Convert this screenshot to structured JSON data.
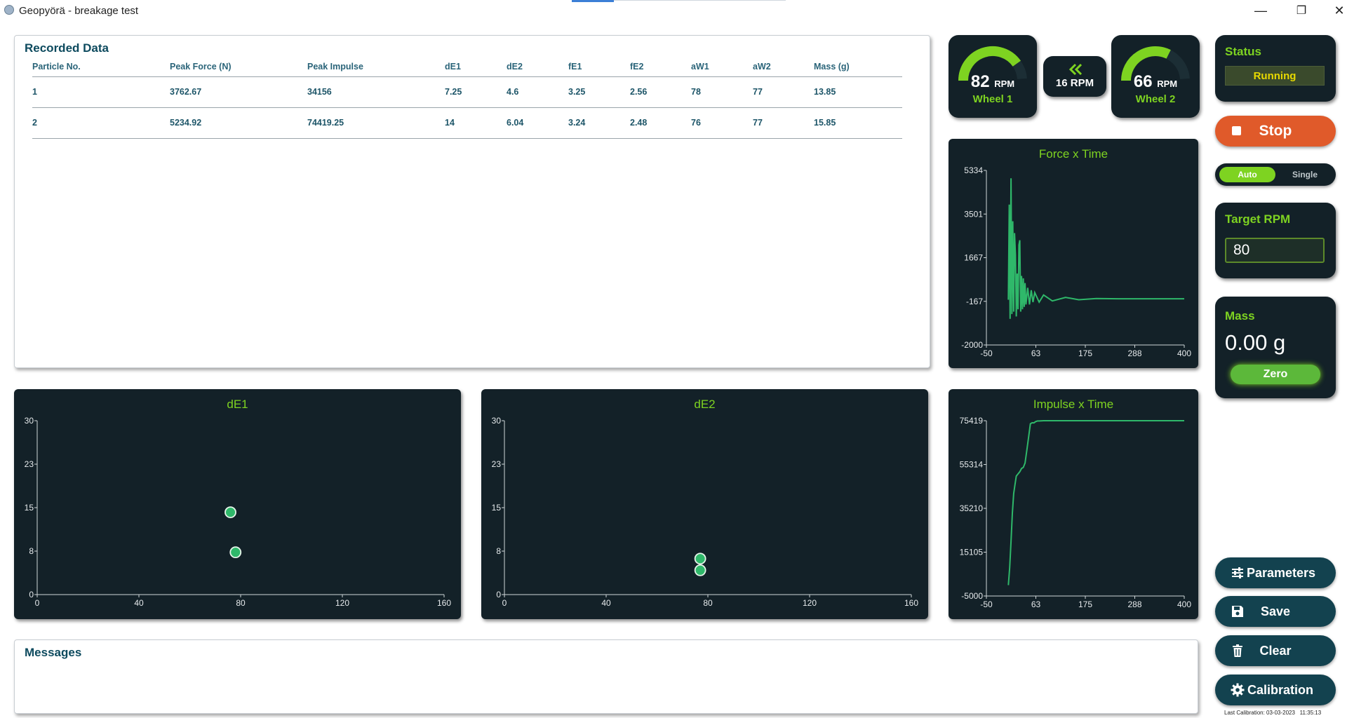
{
  "window": {
    "title": "Geopyörä - breakage test",
    "minimize": "—",
    "restore": "❐",
    "close": "✕"
  },
  "recorded": {
    "title": "Recorded Data",
    "columns": [
      "Particle No.",
      "Peak Force (N)",
      "Peak Impulse",
      "dE1",
      "dE2",
      "fE1",
      "fE2",
      "aW1",
      "aW2",
      "Mass (g)"
    ],
    "rows": [
      [
        "1",
        "3762.67",
        "34156",
        "7.25",
        "4.6",
        "3.25",
        "2.56",
        "78",
        "77",
        "13.85"
      ],
      [
        "2",
        "5234.92",
        "74419.25",
        "14",
        "6.04",
        "3.24",
        "2.48",
        "76",
        "77",
        "15.85"
      ]
    ]
  },
  "gauges": {
    "wheel1": {
      "value": "82",
      "unit": "RPM",
      "label": "Wheel 1",
      "fraction": 0.82
    },
    "diff": {
      "icon": "double-chevron-left-icon",
      "value": "16 RPM"
    },
    "wheel2": {
      "value": "66",
      "unit": "RPM",
      "label": "Wheel 2",
      "fraction": 0.66
    }
  },
  "status": {
    "title": "Status",
    "value": "Running"
  },
  "stop_label": "Stop",
  "mode": {
    "options": [
      "Auto",
      "Single"
    ],
    "selected": "Auto"
  },
  "target_rpm": {
    "title": "Target RPM",
    "value": "80"
  },
  "mass": {
    "title": "Mass",
    "value": "0.00 g",
    "zero_label": "Zero"
  },
  "buttons": {
    "parameters": "Parameters",
    "save": "Save",
    "clear": "Clear",
    "calibration": "Calibration"
  },
  "last_calibration": "Last Calibration: 03-03-2023   11:35:13",
  "messages": {
    "title": "Messages"
  },
  "colors": {
    "accent_green": "#7ed321",
    "line_green": "#2fb86a",
    "panel_dark": "#132128",
    "stop_orange": "#e05a2a",
    "teal_button": "#13424f"
  },
  "chart_data": [
    {
      "type": "scatter",
      "title": "dE1",
      "xlim": [
        0,
        160
      ],
      "ylim": [
        0,
        30
      ],
      "xticks": [
        "0",
        "40",
        "80",
        "120",
        "160"
      ],
      "yticks": [
        "0",
        "8",
        "15",
        "23",
        "30"
      ],
      "points": [
        [
          76,
          14.2
        ],
        [
          78,
          7.3
        ]
      ]
    },
    {
      "type": "scatter",
      "title": "dE2",
      "xlim": [
        0,
        160
      ],
      "ylim": [
        0,
        30
      ],
      "xticks": [
        "0",
        "40",
        "80",
        "120",
        "160"
      ],
      "yticks": [
        "0",
        "8",
        "15",
        "23",
        "30"
      ],
      "points": [
        [
          77,
          6.2
        ],
        [
          77,
          4.2
        ]
      ]
    },
    {
      "type": "line",
      "title": "Force x Time",
      "xlim": [
        -50,
        400
      ],
      "ylim": [
        -2000,
        5334
      ],
      "xticks": [
        "-50",
        "63",
        "175",
        "288",
        "400"
      ],
      "yticks": [
        "-2000",
        "-167",
        "1667",
        "3501",
        "5334"
      ],
      "series": [
        {
          "x": [
            0,
            2,
            4,
            6,
            8,
            10,
            12,
            14,
            16,
            18,
            20,
            22,
            24,
            26,
            28,
            30,
            32,
            34,
            36,
            38,
            40,
            44,
            48,
            52,
            56,
            60,
            70,
            80,
            100,
            130,
            160,
            200,
            250,
            300,
            350,
            400
          ],
          "y": [
            -100,
            3900,
            -900,
            5000,
            -700,
            3200,
            -600,
            2700,
            1800,
            -800,
            1000,
            -500,
            2200,
            2400,
            -600,
            900,
            -500,
            800,
            -400,
            600,
            -300,
            400,
            -300,
            300,
            -200,
            200,
            -200,
            100,
            -150,
            0,
            -100,
            -50,
            -60,
            -60,
            -60,
            -60
          ]
        }
      ]
    },
    {
      "type": "line",
      "title": "Impulse x Time",
      "xlim": [
        -50,
        400
      ],
      "ylim": [
        -5000,
        75419
      ],
      "xticks": [
        "-50",
        "63",
        "175",
        "288",
        "400"
      ],
      "yticks": [
        "-5000",
        "15105",
        "35210",
        "55314",
        "75419"
      ],
      "series": [
        {
          "x": [
            0,
            3,
            6,
            9,
            12,
            15,
            18,
            22,
            26,
            30,
            34,
            38,
            42,
            46,
            50,
            54,
            58,
            62,
            66,
            70,
            80,
            100,
            150,
            200,
            250,
            300,
            350,
            400
          ],
          "y": [
            0,
            8000,
            20000,
            33000,
            42000,
            46000,
            50000,
            51000,
            52000,
            53500,
            54000,
            56000,
            62000,
            68000,
            74000,
            74500,
            74419,
            75000,
            75300,
            75300,
            75419,
            75419,
            75419,
            75419,
            75419,
            75419,
            75419,
            75419
          ]
        }
      ]
    }
  ]
}
